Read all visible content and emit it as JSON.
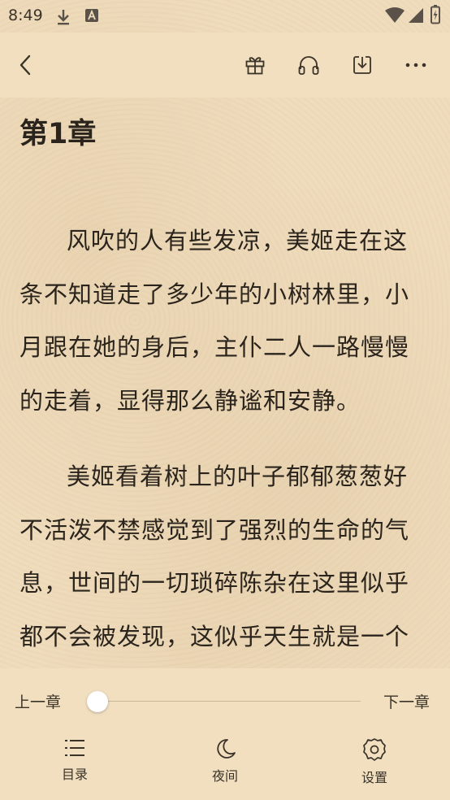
{
  "status_bar": {
    "time": "8:49",
    "icons": [
      "download-icon",
      "a-notification-icon",
      "wifi-icon",
      "signal-icon",
      "battery-icon"
    ]
  },
  "top_bar": {
    "icons": [
      "back-arrow-icon",
      "gift-icon",
      "headphones-icon",
      "download-icon",
      "more-icon"
    ]
  },
  "chapter": {
    "title": "第1章",
    "paragraphs": [
      "风吹的人有些发凉，美姬走在这条不知道走了多少年的小树林里，小月跟在她的身后，主仆二人一路慢慢的走着，显得那么静谧和安静。",
      "美姬看着树上的叶子郁郁葱葱好不活泼不禁感觉到了强烈的生命的气息，世间的一切琐碎陈杂在这里似乎都不会被发现，这似乎天生就是一个"
    ]
  },
  "reader_controls": {
    "prev_chapter": "上一章",
    "next_chapter": "下一章",
    "progress": 0.0
  },
  "bottom_nav": {
    "items": [
      {
        "label": "目录",
        "icon": "menu-list-icon"
      },
      {
        "label": "夜间",
        "icon": "moon-icon"
      },
      {
        "label": "设置",
        "icon": "gear-icon"
      }
    ]
  },
  "colors": {
    "background": "#efdcbc",
    "text": "#2a241c"
  }
}
